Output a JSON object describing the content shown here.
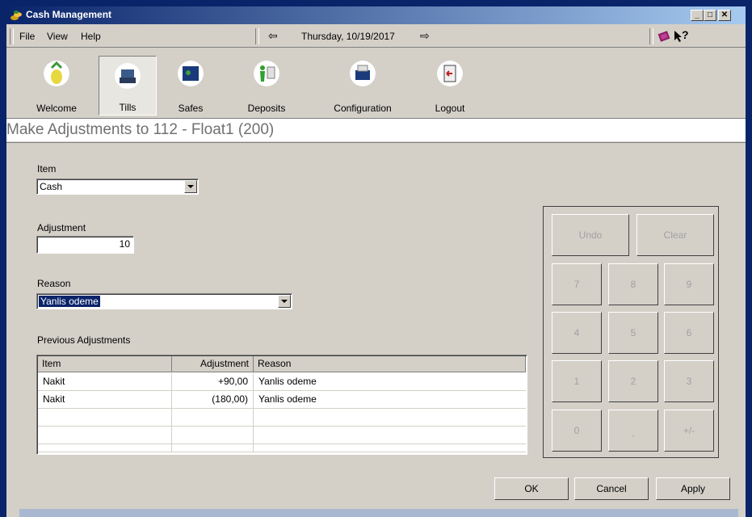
{
  "window": {
    "title": "Cash Management"
  },
  "menu": {
    "file": "File",
    "view": "View",
    "help": "Help",
    "date": "Thursday, 10/19/2017",
    "prev_arrow": "⇦",
    "next_arrow": "⇨",
    "help_icon": "?"
  },
  "toolbar": [
    {
      "label": "Welcome",
      "icon": "pineapple-icon",
      "selected": false
    },
    {
      "label": "Tills",
      "icon": "register-icon",
      "selected": true
    },
    {
      "label": "Safes",
      "icon": "safe-icon",
      "selected": false
    },
    {
      "label": "Deposits",
      "icon": "deposit-icon",
      "selected": false
    },
    {
      "label": "Configuration",
      "icon": "printer-icon",
      "selected": false
    },
    {
      "label": "Logout",
      "icon": "logout-icon",
      "selected": false
    }
  ],
  "heading": "Make Adjustments to 112 - Float1 (200)",
  "form": {
    "item_label": "Item",
    "item_value": "Cash",
    "adjustment_label": "Adjustment",
    "adjustment_value": "10",
    "reason_label": "Reason",
    "reason_value": "Yanlis odeme",
    "previous_label": "Previous Adjustments"
  },
  "grid": {
    "headers": [
      "Item",
      "Adjustment",
      "Reason"
    ],
    "rows": [
      [
        "Nakit",
        "+90,00",
        "Yanlis odeme"
      ],
      [
        "Nakit",
        "(180,00)",
        "Yanlis odeme"
      ]
    ]
  },
  "keypad": {
    "undo": "Undo",
    "clear": "Clear",
    "k7": "7",
    "k8": "8",
    "k9": "9",
    "k4": "4",
    "k5": "5",
    "k6": "6",
    "k1": "1",
    "k2": "2",
    "k3": "3",
    "k0": "0",
    "comma": ",",
    "plusminus": "+/-"
  },
  "footer": {
    "ok": "OK",
    "cancel": "Cancel",
    "apply": "Apply"
  },
  "colors": {
    "titlebar": "#0a246a",
    "face": "#d4d0c8",
    "selection": "#0a246a"
  }
}
